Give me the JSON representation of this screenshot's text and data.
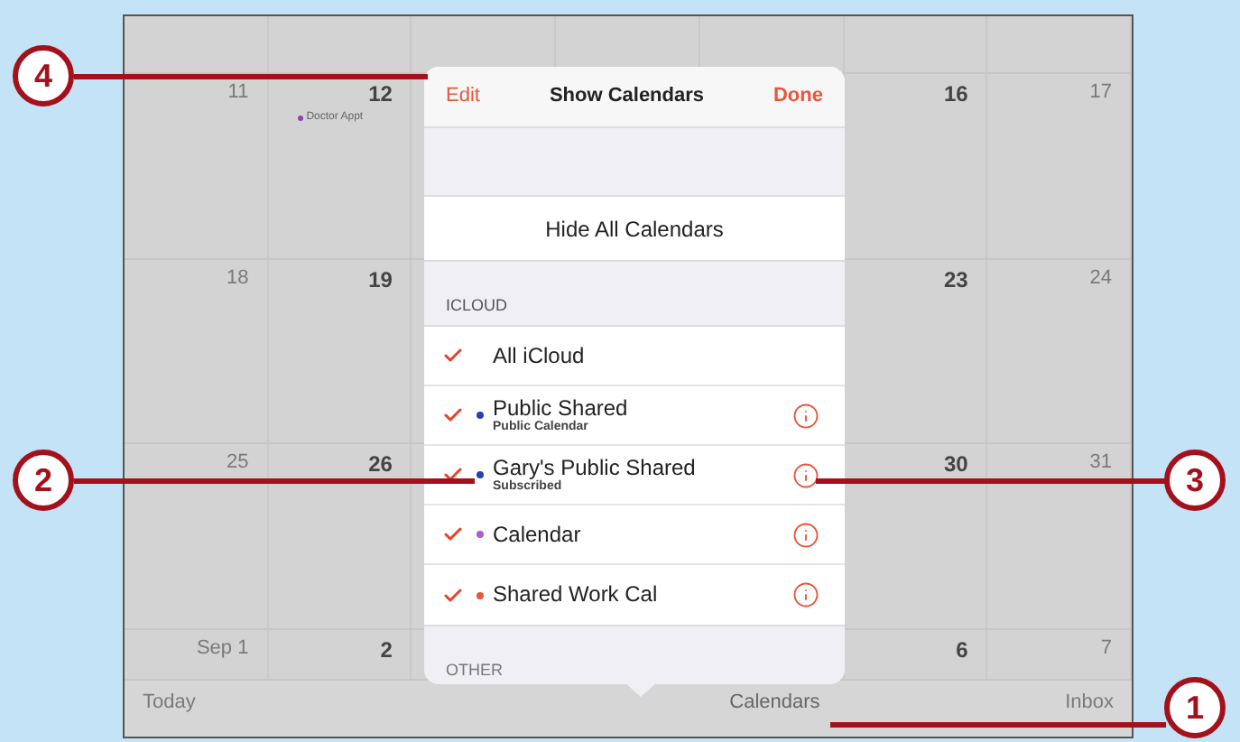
{
  "calendar": {
    "weeks": [
      [
        {
          "label": "11",
          "weekend": true
        },
        {
          "label": "12",
          "weekend": false,
          "events": [
            {
              "title": "Doctor Appt",
              "color": "#8e44ad"
            }
          ]
        },
        {
          "label": "16",
          "weekend": false
        },
        {
          "label": "17",
          "weekend": true
        }
      ],
      [
        {
          "label": "18",
          "weekend": true
        },
        {
          "label": "19",
          "weekend": false
        },
        {
          "label": "23",
          "weekend": false
        },
        {
          "label": "24",
          "weekend": true
        }
      ],
      [
        {
          "label": "25",
          "weekend": true
        },
        {
          "label": "26",
          "weekend": false
        },
        {
          "label": "30",
          "weekend": false
        },
        {
          "label": "31",
          "weekend": true
        }
      ],
      [
        {
          "label": "Sep 1",
          "weekend": true
        },
        {
          "label": "2",
          "weekend": false
        },
        {
          "label": "6",
          "weekend": false
        },
        {
          "label": "7",
          "weekend": true
        }
      ]
    ]
  },
  "toolbar": {
    "today": "Today",
    "calendars": "Calendars",
    "inbox": "Inbox"
  },
  "popover": {
    "edit": "Edit",
    "title": "Show Calendars",
    "done": "Done",
    "hide_all": "Hide All Calendars",
    "section": "ICLOUD",
    "items": [
      {
        "name": "All iCloud",
        "checked": true,
        "info": false
      },
      {
        "name": "Public Shared",
        "subtitle": "Public Calendar",
        "checked": true,
        "color": "#2c3fa8",
        "info": true
      },
      {
        "name": "Gary's Public Shared",
        "subtitle": "Subscribed",
        "checked": true,
        "color": "#2c3fa8",
        "info": true
      },
      {
        "name": "Calendar",
        "checked": true,
        "color": "#b05ad0",
        "info": true
      },
      {
        "name": "Shared Work Cal",
        "checked": true,
        "color": "#e8553a",
        "info": true
      }
    ],
    "other_section": "OTHER"
  },
  "callouts": [
    {
      "number": "4"
    },
    {
      "number": "2"
    },
    {
      "number": "3"
    },
    {
      "number": "1"
    }
  ]
}
